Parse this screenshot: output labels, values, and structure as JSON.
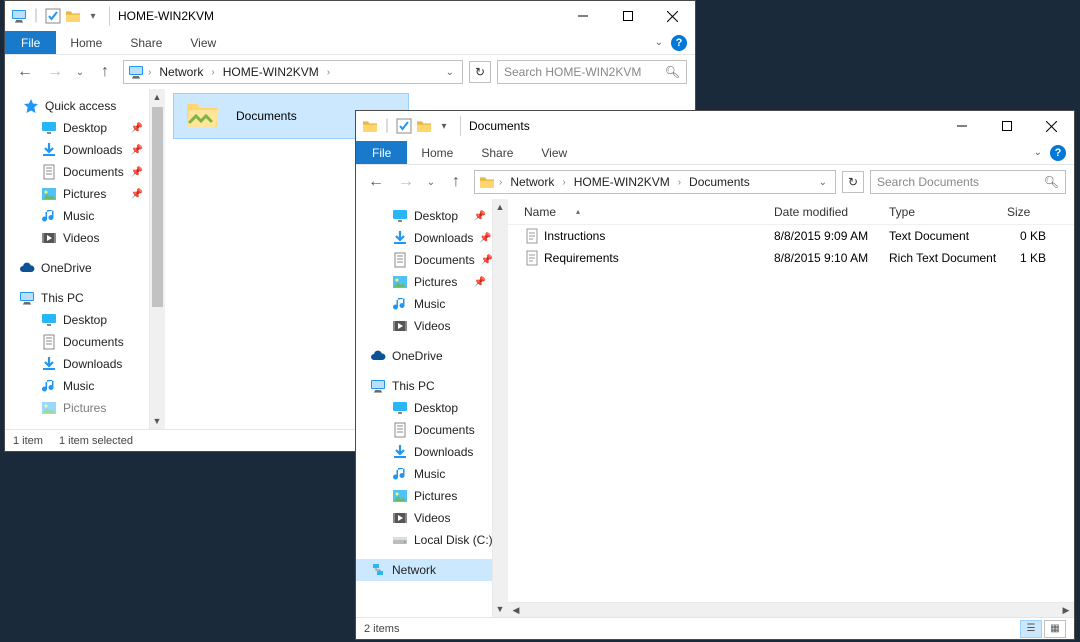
{
  "window1": {
    "title": "HOME-WIN2KVM",
    "ribbon": {
      "file": "File",
      "home": "Home",
      "share": "Share",
      "view": "View"
    },
    "breadcrumbs": [
      "Network",
      "HOME-WIN2KVM"
    ],
    "search_placeholder": "Search HOME-WIN2KVM",
    "nav": {
      "quick_access": "Quick access",
      "desktop": "Desktop",
      "downloads": "Downloads",
      "documents": "Documents",
      "pictures": "Pictures",
      "music": "Music",
      "videos": "Videos",
      "onedrive": "OneDrive",
      "this_pc": "This PC",
      "pc_desktop": "Desktop",
      "pc_documents": "Documents",
      "pc_downloads": "Downloads",
      "pc_music": "Music",
      "pc_pictures": "Pictures"
    },
    "tile_label": "Documents",
    "status_items": "1 item",
    "status_selected": "1 item selected"
  },
  "window2": {
    "title": "Documents",
    "ribbon": {
      "file": "File",
      "home": "Home",
      "share": "Share",
      "view": "View"
    },
    "breadcrumbs": [
      "Network",
      "HOME-WIN2KVM",
      "Documents"
    ],
    "search_placeholder": "Search Documents",
    "columns": {
      "name": "Name",
      "date": "Date modified",
      "type": "Type",
      "size": "Size"
    },
    "files": [
      {
        "name": "Instructions",
        "date": "8/8/2015 9:09 AM",
        "type": "Text Document",
        "size": "0 KB"
      },
      {
        "name": "Requirements",
        "date": "8/8/2015 9:10 AM",
        "type": "Rich Text Document",
        "size": "1 KB"
      }
    ],
    "nav": {
      "desktop": "Desktop",
      "downloads": "Downloads",
      "documents": "Documents",
      "pictures": "Pictures",
      "music": "Music",
      "videos": "Videos",
      "onedrive": "OneDrive",
      "this_pc": "This PC",
      "pc_desktop": "Desktop",
      "pc_documents": "Documents",
      "pc_downloads": "Downloads",
      "pc_music": "Music",
      "pc_pictures": "Pictures",
      "pc_videos": "Videos",
      "local_disk": "Local Disk (C:)",
      "network": "Network"
    },
    "status_items": "2 items"
  }
}
